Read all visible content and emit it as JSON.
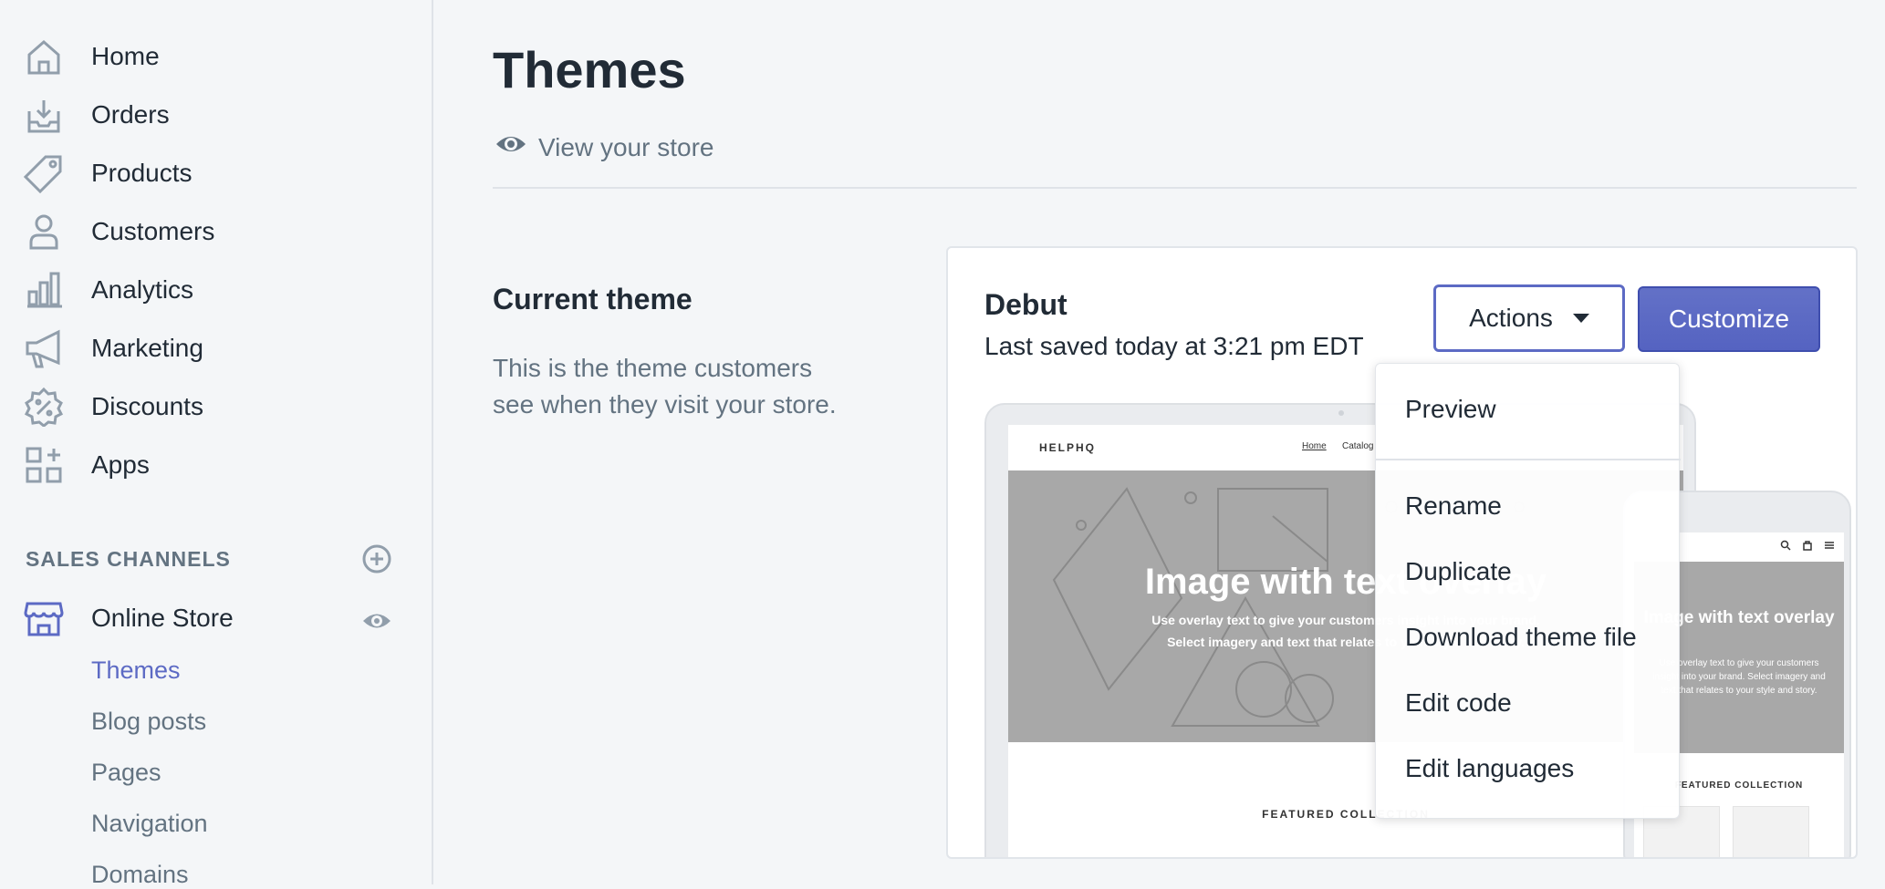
{
  "sidebar": {
    "items": [
      {
        "label": "Home",
        "icon": "home-icon"
      },
      {
        "label": "Orders",
        "icon": "orders-icon"
      },
      {
        "label": "Products",
        "icon": "tag-icon"
      },
      {
        "label": "Customers",
        "icon": "person-icon"
      },
      {
        "label": "Analytics",
        "icon": "bar-chart-icon"
      },
      {
        "label": "Marketing",
        "icon": "megaphone-icon"
      },
      {
        "label": "Discounts",
        "icon": "discount-icon"
      },
      {
        "label": "Apps",
        "icon": "apps-icon"
      }
    ],
    "sales_channels_title": "SALES CHANNELS",
    "online_store": {
      "label": "Online Store",
      "subitems": [
        {
          "label": "Themes",
          "active": true
        },
        {
          "label": "Blog posts",
          "active": false
        },
        {
          "label": "Pages",
          "active": false
        },
        {
          "label": "Navigation",
          "active": false
        },
        {
          "label": "Domains",
          "active": false
        }
      ]
    }
  },
  "main": {
    "title": "Themes",
    "view_store": "View your store",
    "current_theme": {
      "heading": "Current theme",
      "description": "This is the theme customers see when they visit your store."
    },
    "card": {
      "theme_name": "Debut",
      "last_saved": "Last saved today at 3:21 pm EDT",
      "actions_label": "Actions",
      "customize_label": "Customize"
    },
    "preview": {
      "brand": "HELPHQ",
      "nav_home": "Home",
      "nav_catalog": "Catalog",
      "hero_title": "Image with text overlay",
      "hero_sub1": "Use overlay text to give your customers insight into your brand.",
      "hero_sub2": "Select imagery and text that relates to your style and story.",
      "featured": "FEATURED COLLECTION",
      "phone_hero_title": "Image with text overlay",
      "phone_hero_sub": "Use overlay text to give your customers insight into your brand. Select imagery and text that relates to your style and story.",
      "phone_featured": "FEATURED COLLECTION"
    }
  },
  "dropdown": {
    "items": [
      "Preview",
      "Rename",
      "Duplicate",
      "Download theme file",
      "Edit code",
      "Edit languages"
    ]
  },
  "colors": {
    "accent": "#5c6ac4",
    "text": "#212b36",
    "subdued": "#637381",
    "background": "#f4f6f8"
  }
}
